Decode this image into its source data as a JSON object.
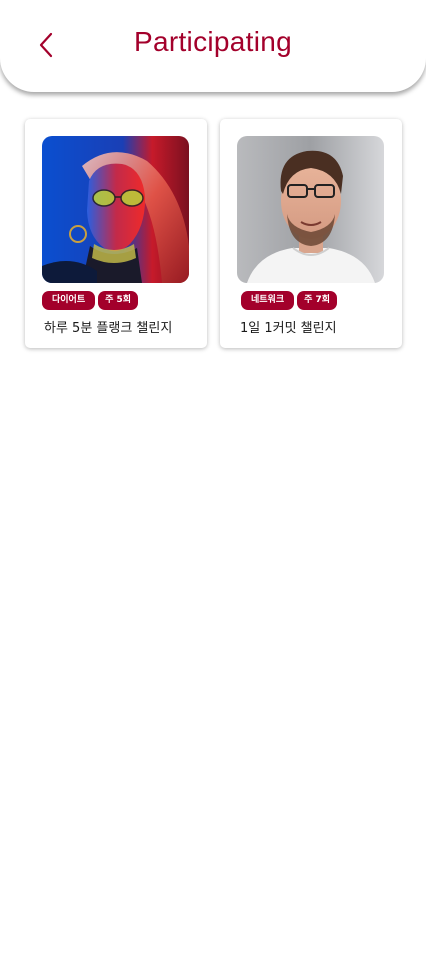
{
  "header": {
    "title": "Participating",
    "back_icon": "chevron-left-icon"
  },
  "colors": {
    "accent": "#A3002B",
    "background": "#FFFFFF",
    "text": "#1A1A1A"
  },
  "challenges": [
    {
      "image": "portrait-woman-neon-glasses",
      "tags": [
        "다이어트",
        "주 5회"
      ],
      "title": "하루 5분 플랭크 챌린지"
    },
    {
      "image": "portrait-man-glasses",
      "tags": [
        "네트워크",
        "주 7회"
      ],
      "title": "1일 1커밋 챌린지"
    }
  ]
}
